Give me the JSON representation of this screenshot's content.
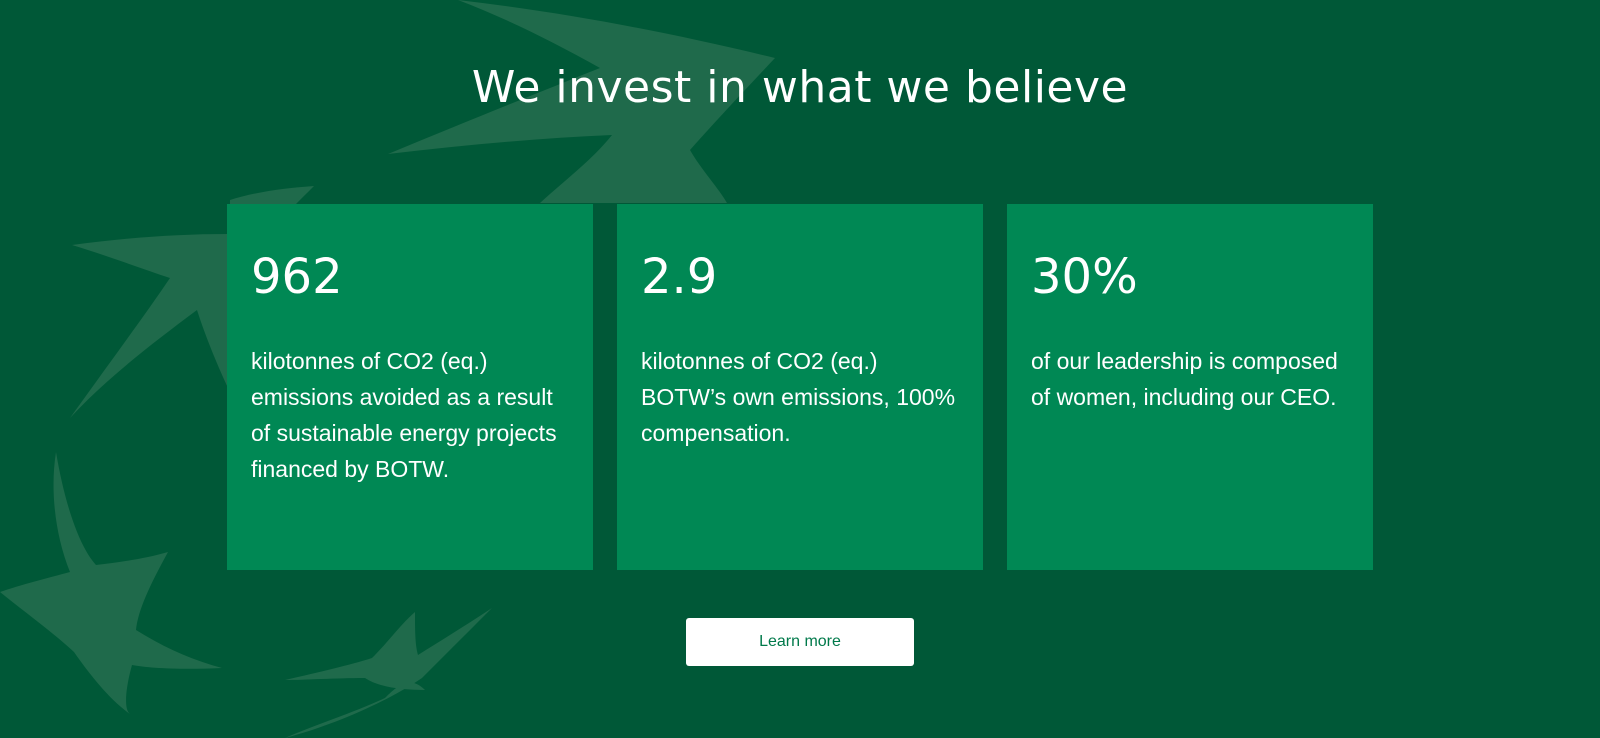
{
  "section": {
    "title": "We invest in what we believe"
  },
  "cards": [
    {
      "stat": "962",
      "description": "kilotonnes of CO2 (eq.) emissions avoided as a result of sustainable energy projects financed by BOTW."
    },
    {
      "stat": "2.9",
      "description": "kilotonnes of CO2 (eq.) BOTW’s own emissions, 100% compensation."
    },
    {
      "stat": "30%",
      "description": "of our leadership is composed of women, including our CEO."
    }
  ],
  "cta": {
    "label": "Learn more"
  },
  "colors": {
    "background": "#005837",
    "card": "#008854",
    "button_text": "#00794a",
    "decor": "#1f6a4b"
  }
}
